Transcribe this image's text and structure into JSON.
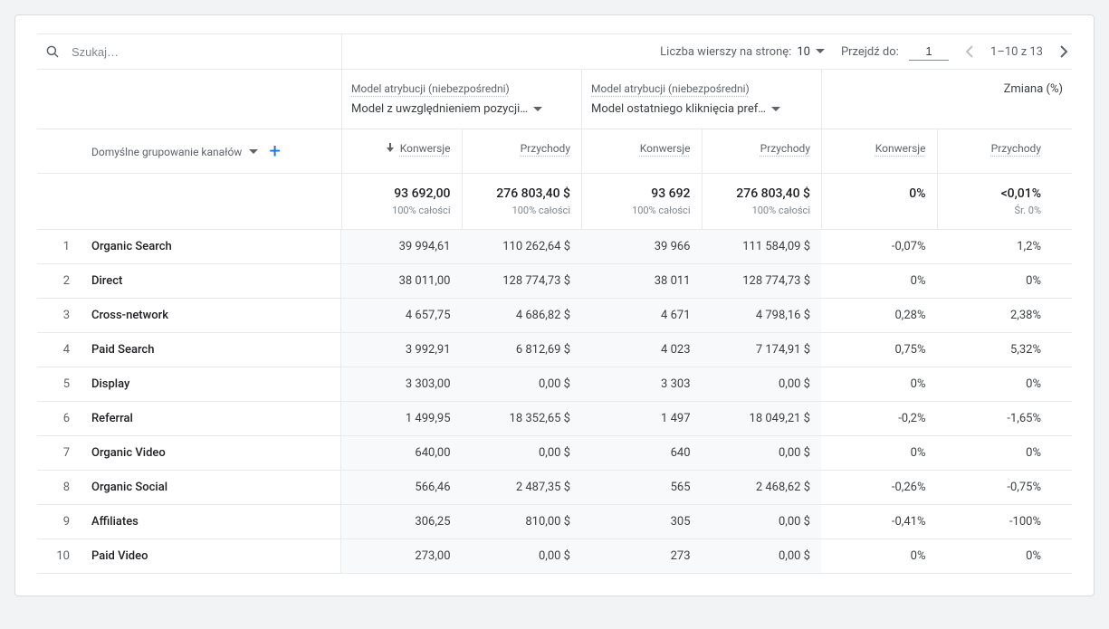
{
  "search": {
    "placeholder": "Szukaj…"
  },
  "pager": {
    "rowsPerPageLabel": "Liczba wierszy na stronę:",
    "rowsPerPage": "10",
    "gotoLabel": "Przejdź do:",
    "gotoValue": "1",
    "range": "1–10 z 13"
  },
  "attribution": {
    "colLabel": "Model atrybucji (niebezpośredni)",
    "model1": "Model z uwzględnieniem pozycji…",
    "model2": "Model ostatniego kliknięcia pref…",
    "changeLabel": "Zmiana (%)"
  },
  "dimension": {
    "label": "Domyślne grupowanie kanałów"
  },
  "metrics": {
    "conv": "Konwersje",
    "rev": "Przychody",
    "conv2": "Konwersje",
    "rev2": "Przychody",
    "conv3": "Konwersje",
    "rev3": "Przychody"
  },
  "totals": {
    "c1": {
      "v": "93 692,00",
      "s": "100% całości"
    },
    "r1": {
      "v": "276 803,40 $",
      "s": "100% całości"
    },
    "c2": {
      "v": "93 692",
      "s": "100% całości"
    },
    "r2": {
      "v": "276 803,40 $",
      "s": "100% całości"
    },
    "c3": {
      "v": "0%",
      "s": ""
    },
    "r3": {
      "v": "<0,01%",
      "s": "Śr. 0%"
    }
  },
  "rows": [
    {
      "i": "1",
      "name": "Organic Search",
      "c1": "39 994,61",
      "r1": "110 262,64 $",
      "c2": "39 966",
      "r2": "111 584,09 $",
      "c3": "-0,07%",
      "r3": "1,2%"
    },
    {
      "i": "2",
      "name": "Direct",
      "c1": "38 011,00",
      "r1": "128 774,73 $",
      "c2": "38 011",
      "r2": "128 774,73 $",
      "c3": "0%",
      "r3": "0%"
    },
    {
      "i": "3",
      "name": "Cross-network",
      "c1": "4 657,75",
      "r1": "4 686,82 $",
      "c2": "4 671",
      "r2": "4 798,16 $",
      "c3": "0,28%",
      "r3": "2,38%"
    },
    {
      "i": "4",
      "name": "Paid Search",
      "c1": "3 992,91",
      "r1": "6 812,69 $",
      "c2": "4 023",
      "r2": "7 174,91 $",
      "c3": "0,75%",
      "r3": "5,32%"
    },
    {
      "i": "5",
      "name": "Display",
      "c1": "3 303,00",
      "r1": "0,00 $",
      "c2": "3 303",
      "r2": "0,00 $",
      "c3": "0%",
      "r3": "0%"
    },
    {
      "i": "6",
      "name": "Referral",
      "c1": "1 499,95",
      "r1": "18 352,65 $",
      "c2": "1 497",
      "r2": "18 049,21 $",
      "c3": "-0,2%",
      "r3": "-1,65%"
    },
    {
      "i": "7",
      "name": "Organic Video",
      "c1": "640,00",
      "r1": "0,00 $",
      "c2": "640",
      "r2": "0,00 $",
      "c3": "0%",
      "r3": "0%"
    },
    {
      "i": "8",
      "name": "Organic Social",
      "c1": "566,46",
      "r1": "2 487,35 $",
      "c2": "565",
      "r2": "2 468,62 $",
      "c3": "-0,26%",
      "r3": "-0,75%"
    },
    {
      "i": "9",
      "name": "Affiliates",
      "c1": "306,25",
      "r1": "810,00 $",
      "c2": "305",
      "r2": "0,00 $",
      "c3": "-0,41%",
      "r3": "-100%"
    },
    {
      "i": "10",
      "name": "Paid Video",
      "c1": "273,00",
      "r1": "0,00 $",
      "c2": "273",
      "r2": "0,00 $",
      "c3": "0%",
      "r3": "0%"
    }
  ]
}
